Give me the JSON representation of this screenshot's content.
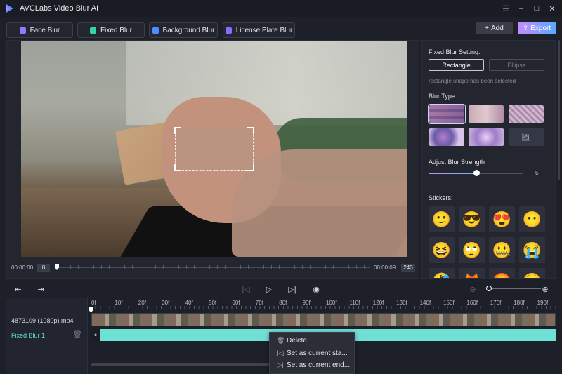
{
  "app": {
    "title": "AVCLabs Video Blur AI"
  },
  "window_controls": {
    "menu": "☰",
    "minimize": "–",
    "maximize": "□",
    "close": "✕"
  },
  "modes": [
    {
      "label": "Face Blur",
      "color": "#8c7dff"
    },
    {
      "label": "Fixed Blur",
      "color": "#33d6a0"
    },
    {
      "label": "Background Blur",
      "color": "#4f8dff"
    },
    {
      "label": "License Plate Blur",
      "color": "#8a6dff"
    }
  ],
  "actions": {
    "add": "Add",
    "add_icon": "+",
    "export": "Export",
    "export_icon": "⇪"
  },
  "preview": {
    "time_start": "00:00:00",
    "frame_start": "0",
    "time_end": "00:00:09",
    "frame_end": "243"
  },
  "panel": {
    "fixed_setting_label": "Fixed Blur Setting:",
    "shape_rect": "Rectangle",
    "shape_ellipse": "Ellipse",
    "shape_hint": "rectangle shape has been selected",
    "blur_type_label": "Blur Type:",
    "strength_label": "Adjust Blur Strength",
    "strength_value": "5",
    "strength_fraction": 0.5,
    "stickers_label": "Stickers:",
    "stickers": [
      "🙂",
      "😎",
      "😍",
      "😶",
      "😆",
      "🙄",
      "🤐",
      "😭",
      "🤣",
      "🦊",
      "😡",
      "😵"
    ]
  },
  "timeline": {
    "ruler_labels": [
      "0f",
      "10f",
      "20f",
      "30f",
      "40f",
      "50f",
      "60f",
      "70f",
      "80f",
      "90f",
      "100f",
      "110f",
      "120f",
      "130f",
      "140f",
      "150f",
      "160f",
      "170f",
      "180f",
      "190f"
    ],
    "tracks": [
      {
        "name": "4873109 (1080p).mp4",
        "color": "#d6d8de"
      },
      {
        "name": "Fixed Blur 1",
        "color": "#5fe0d1"
      }
    ],
    "grip_icon": "⏸"
  },
  "context_menu": {
    "items": [
      {
        "label": "Delete",
        "icon": "🗑"
      },
      {
        "label": "Set as current sta...",
        "icon": "|◁"
      },
      {
        "label": "Set as current end...",
        "icon": "▷|"
      }
    ]
  }
}
